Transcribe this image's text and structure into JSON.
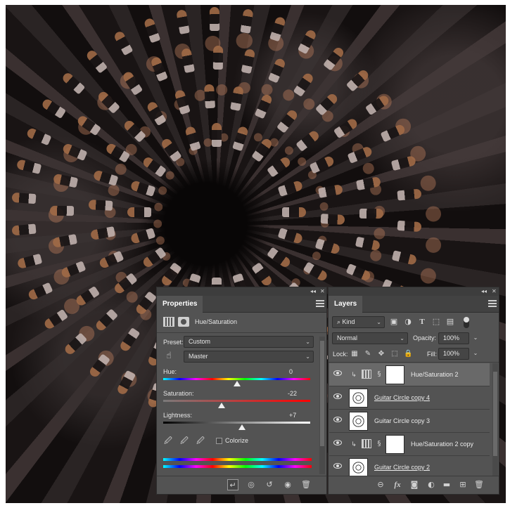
{
  "properties": {
    "tab_label": "Properties",
    "adjustment_title": "Hue/Saturation",
    "preset_label": "Preset:",
    "preset_value": "Custom",
    "channel_value": "Master",
    "hue_label": "Hue:",
    "hue_value": "0",
    "saturation_label": "Saturation:",
    "saturation_value": "-22",
    "lightness_label": "Lightness:",
    "lightness_value": "+7",
    "colorize_label": "Colorize"
  },
  "layers": {
    "tab_label": "Layers",
    "filter_value": "Kind",
    "blend_mode": "Normal",
    "opacity_label": "Opacity:",
    "opacity_value": "100%",
    "lock_label": "Lock:",
    "fill_label": "Fill:",
    "fill_value": "100%",
    "items": [
      {
        "name": "Hue/Saturation 2",
        "type": "adjustment",
        "selected": true
      },
      {
        "name": "Guitar Circle copy 4",
        "type": "smart-object",
        "selected": false
      },
      {
        "name": "Guitar Circle copy 3",
        "type": "smart-object",
        "selected": false
      },
      {
        "name": "Hue/Saturation 2 copy",
        "type": "adjustment",
        "selected": false
      },
      {
        "name": "Guitar Circle copy 2",
        "type": "smart-object",
        "selected": false
      }
    ]
  },
  "icons": {
    "properties_bottom": [
      "clip-to-layer-icon",
      "view-previous-icon",
      "reset-icon",
      "visibility-icon",
      "delete-icon"
    ],
    "layers_bottom": [
      "link-icon",
      "fx-icon",
      "mask-icon",
      "adjustment-icon",
      "folder-icon",
      "new-layer-icon",
      "delete-icon"
    ]
  }
}
